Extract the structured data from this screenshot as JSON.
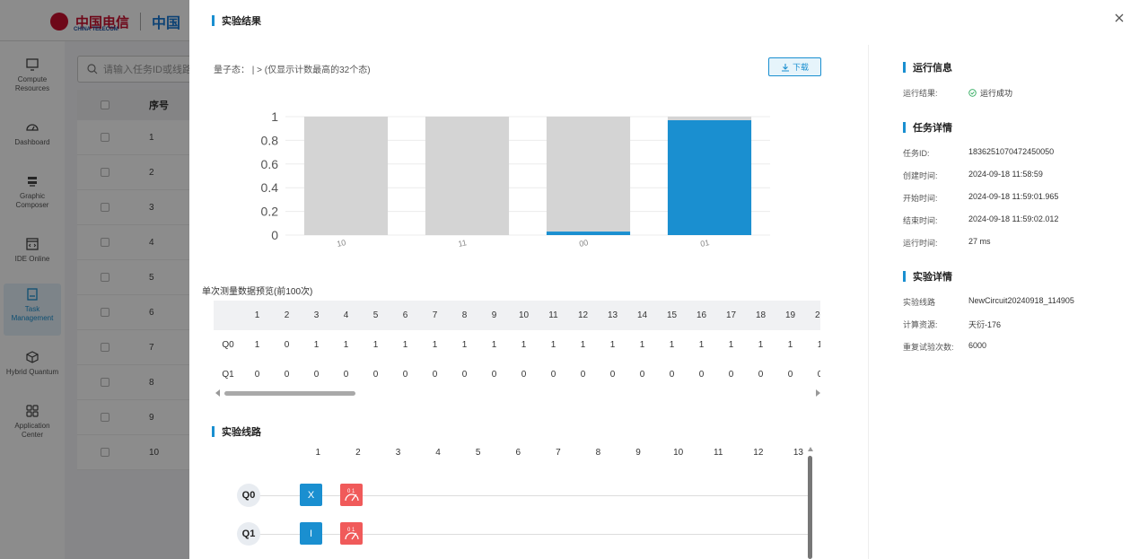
{
  "background_app": {
    "logo_text": "中国电信",
    "logo_en": "CHINA TELECOM",
    "logo_ct": "中国",
    "search_placeholder": "请输入任务ID或线路",
    "table_header": "序号",
    "rows": [
      "1",
      "2",
      "3",
      "4",
      "5",
      "6",
      "7",
      "8",
      "9",
      "10"
    ],
    "sidebar": [
      {
        "label": "Compute Resources",
        "icon": "monitor-icon"
      },
      {
        "label": "Dashboard",
        "icon": "gauge-icon"
      },
      {
        "label": "Graphic Composer",
        "icon": "layers-icon"
      },
      {
        "label": "IDE Online",
        "icon": "code-window-icon"
      },
      {
        "label": "Task Management",
        "icon": "task-icon",
        "active": true
      },
      {
        "label": "Hybrid Quantum",
        "icon": "cube-icon"
      },
      {
        "label": "Application Center",
        "icon": "apps-icon"
      }
    ]
  },
  "drawer": {
    "title": "实验结果",
    "close_icon": "close-icon",
    "quantum_state_label": "量子态： | > (仅显示计数最高的32个态)",
    "download_label": "下载",
    "preview_title": "单次测量数据预览(前100次)",
    "shots": {
      "columns": [
        "1",
        "2",
        "3",
        "4",
        "5",
        "6",
        "7",
        "8",
        "9",
        "10",
        "11",
        "12",
        "13",
        "14",
        "15",
        "16",
        "17",
        "18",
        "19",
        "20"
      ],
      "rows": [
        {
          "label": "Q0",
          "values": [
            "1",
            "0",
            "1",
            "1",
            "1",
            "1",
            "1",
            "1",
            "1",
            "1",
            "1",
            "1",
            "1",
            "1",
            "1",
            "1",
            "1",
            "1",
            "1",
            "1"
          ]
        },
        {
          "label": "Q1",
          "values": [
            "0",
            "0",
            "0",
            "0",
            "0",
            "0",
            "0",
            "0",
            "0",
            "0",
            "0",
            "0",
            "0",
            "0",
            "0",
            "0",
            "0",
            "0",
            "0",
            "0"
          ]
        }
      ]
    },
    "circuit_title": "实验线路",
    "circuit": {
      "columns": [
        "1",
        "2",
        "3",
        "4",
        "5",
        "6",
        "7",
        "8",
        "9",
        "10",
        "11",
        "12",
        "13"
      ],
      "qubits": [
        {
          "label": "Q0",
          "gates": [
            {
              "name": "X",
              "type": "blue"
            },
            {
              "name": "measure",
              "type": "red"
            }
          ]
        },
        {
          "label": "Q1",
          "gates": [
            {
              "name": "I",
              "type": "blue"
            },
            {
              "name": "measure",
              "type": "red"
            }
          ]
        }
      ]
    },
    "run_info": {
      "title": "运行信息",
      "result_key": "运行结果:",
      "result_value": "运行成功"
    },
    "task_details": {
      "title": "任务详情",
      "items": [
        {
          "k": "任务ID:",
          "v": "1836251070472450050"
        },
        {
          "k": "创建时间:",
          "v": "2024-09-18 11:58:59"
        },
        {
          "k": "开始时间:",
          "v": "2024-09-18 11:59:01.965"
        },
        {
          "k": "结束时间:",
          "v": "2024-09-18 11:59:02.012"
        },
        {
          "k": "运行时间:",
          "v": "27 ms"
        }
      ]
    },
    "exp_details": {
      "title": "实验详情",
      "items": [
        {
          "k": "实验线路",
          "v": "NewCircuit20240918_114905"
        },
        {
          "k": "计算资源:",
          "v": "天衍-176"
        },
        {
          "k": "重复试验次数:",
          "v": "6000"
        }
      ]
    }
  },
  "chart_data": {
    "type": "bar",
    "categories": [
      "10",
      "11",
      "00",
      "01"
    ],
    "series": [
      {
        "values": [
          0,
          0,
          0.03,
          0.97
        ]
      },
      {
        "values": [
          1,
          1,
          0.97,
          0.03
        ]
      }
    ],
    "ylim": [
      0,
      1
    ],
    "yticks": [
      "1",
      "0.8",
      "0.6",
      "0.4",
      "0.2",
      "0"
    ],
    "colors": {
      "value": "#1a8fd0",
      "remainder": "#d4d4d4"
    },
    "grid": true
  }
}
